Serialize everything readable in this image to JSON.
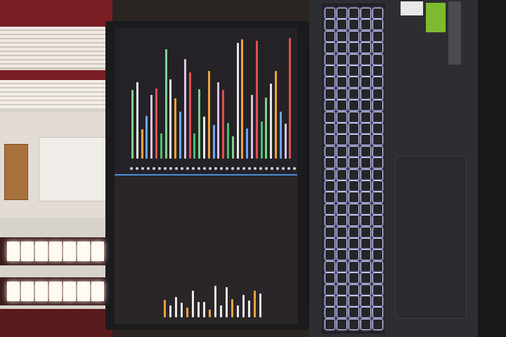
{
  "scene": {
    "subject": "laptop",
    "colors": {
      "wall": "#e3dcd4",
      "blind_red": "#7a1e24",
      "laptop_body": "#2e2e32",
      "keyboard_backlight": "#cfd0f0",
      "screen_divider": "#4a8fd8",
      "label_green": "#7dbb2e"
    }
  }
}
